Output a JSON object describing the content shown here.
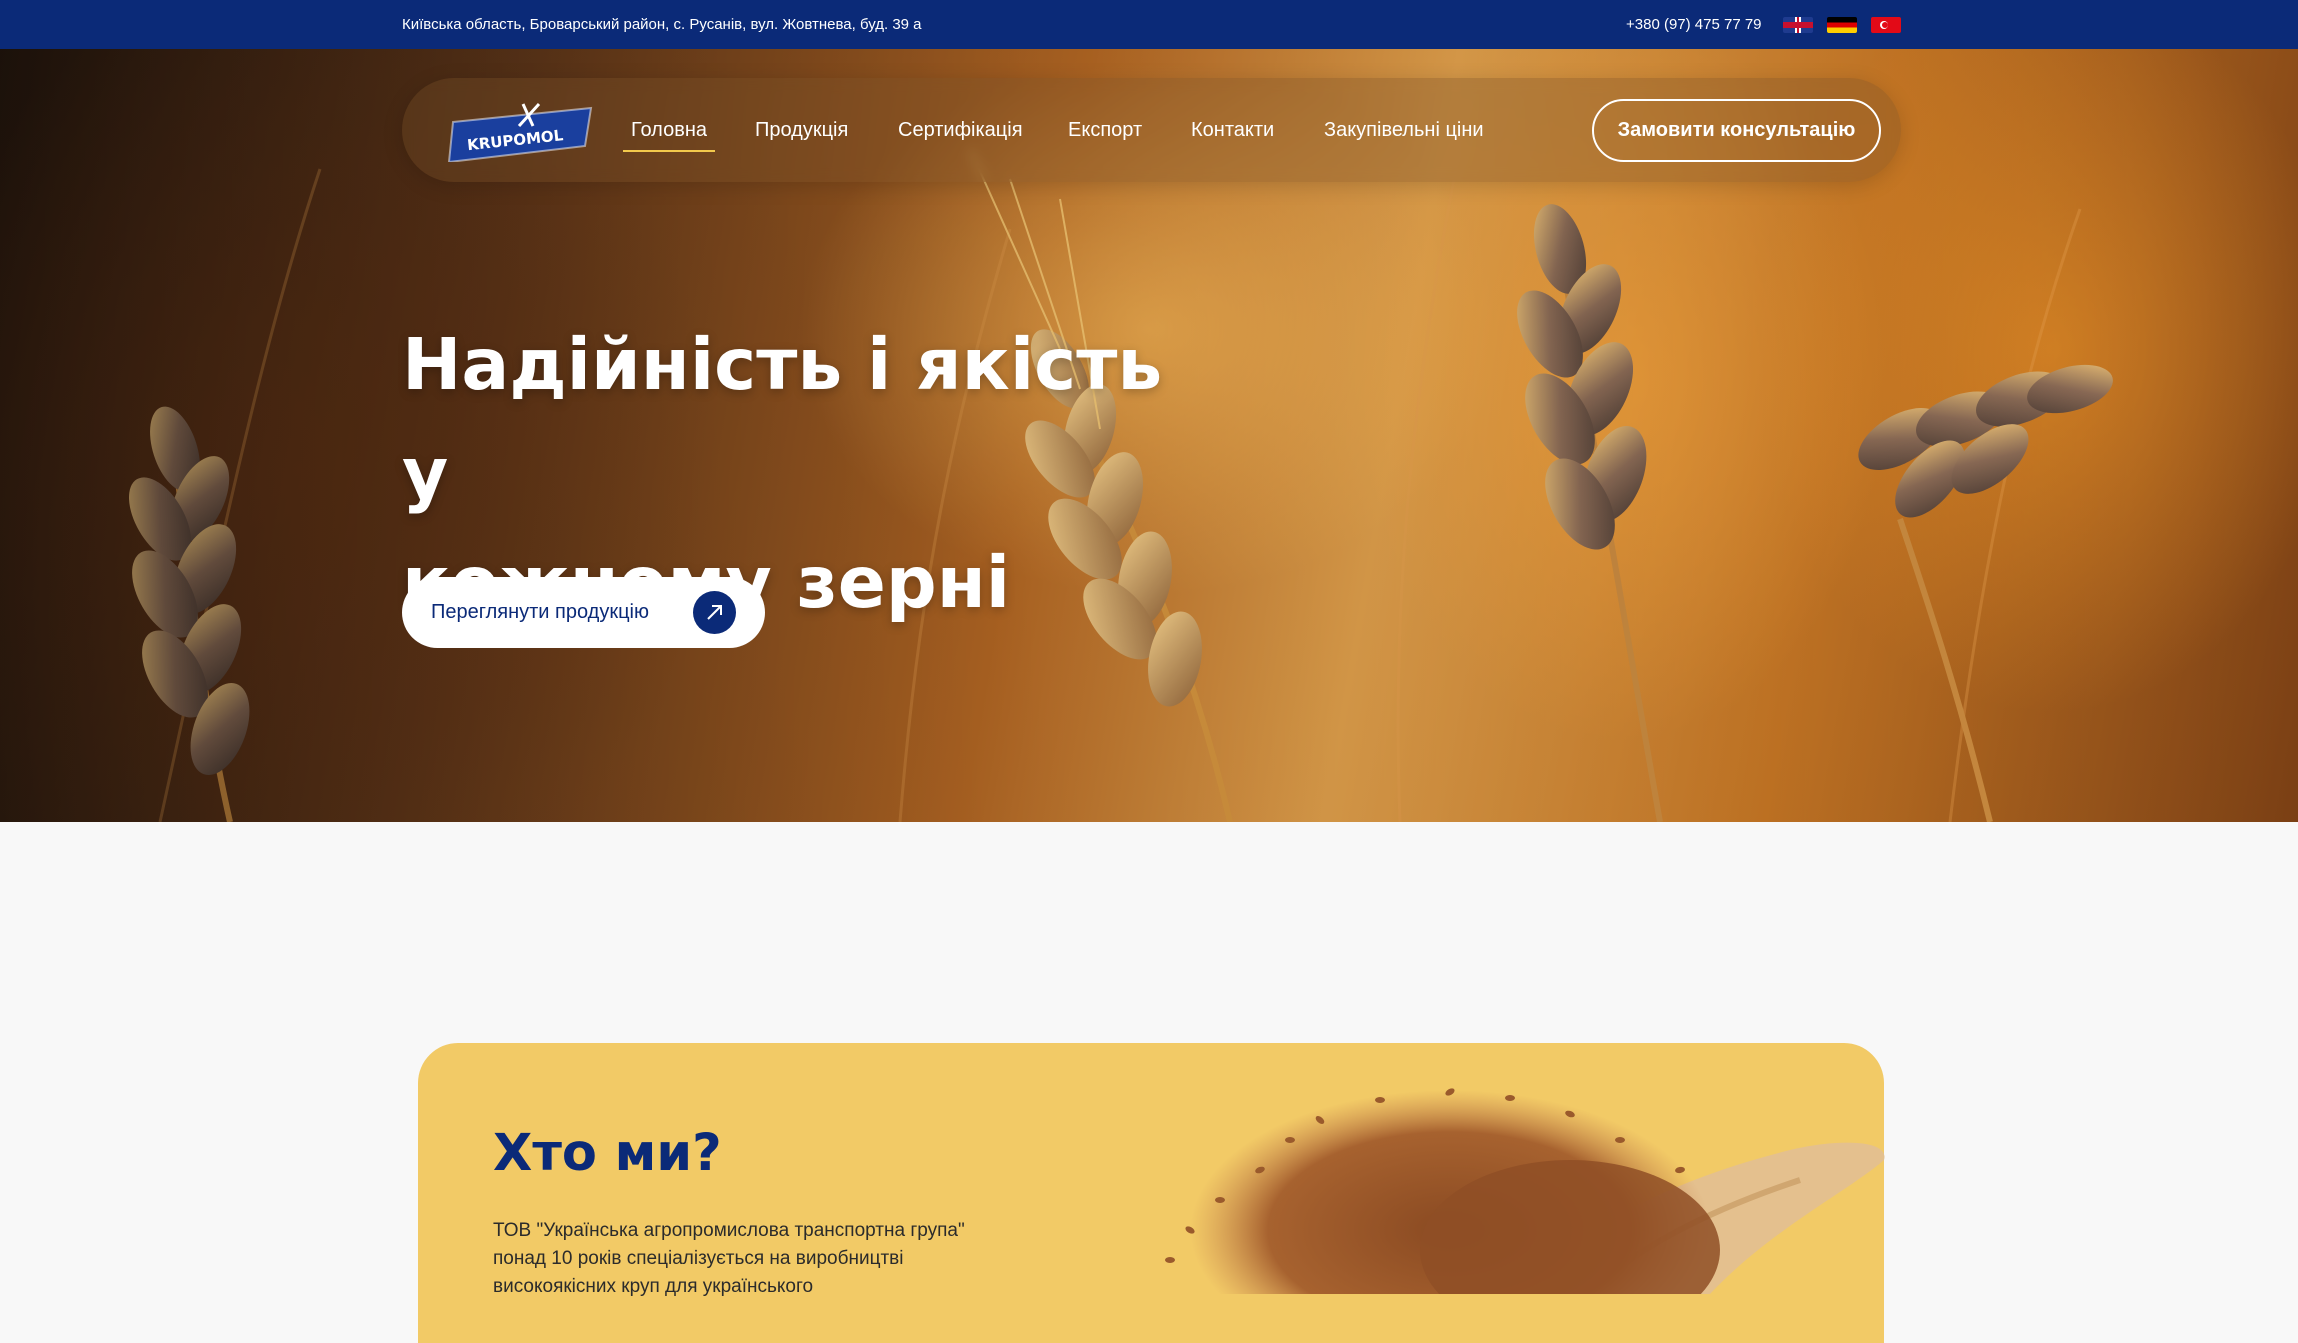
{
  "topbar": {
    "address": "Київська область, Броварський район, с. Русанів, вул. Жовтнева, буд. 39 а",
    "phone": "+380 (97) 475 77 79",
    "languages": [
      "en-flag-icon",
      "de-flag-icon",
      "tr-flag-icon"
    ]
  },
  "nav": {
    "logo_text": "KRUPOMOL",
    "items": [
      {
        "label": "Головна",
        "active": true
      },
      {
        "label": "Продукція"
      },
      {
        "label": "Сертифікація"
      },
      {
        "label": "Експорт"
      },
      {
        "label": "Контакти"
      },
      {
        "label": "Закупівельні ціни"
      }
    ],
    "cta": "Замовити консультацію"
  },
  "hero": {
    "title_line1": "Надійність і якість у",
    "title_line2": "кожному зерні",
    "button_label": "Переглянути продукцію",
    "button_icon": "arrow-up-right-icon"
  },
  "about": {
    "title": "Хто ми?",
    "text": "ТОВ \"Українська агропромислова транспортна група\" понад 10 років спеціалізується на виробництві високоякісних круп для українського"
  },
  "colors": {
    "brand": "#0b2a78",
    "accent": "#f2c94c",
    "card": "#f2ca66"
  }
}
